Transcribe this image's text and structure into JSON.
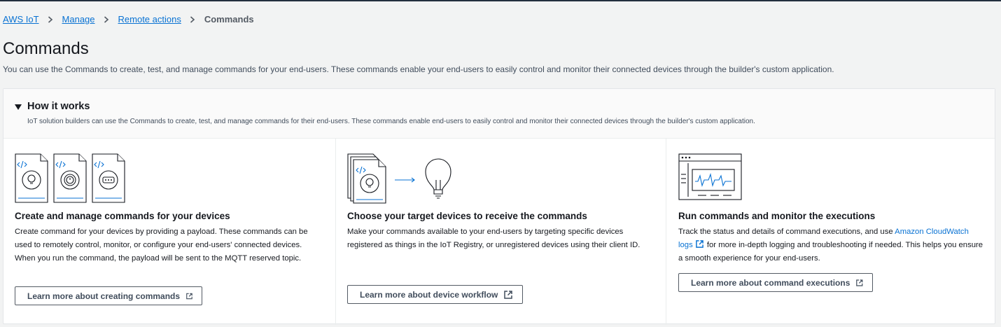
{
  "breadcrumb": {
    "items": [
      "AWS IoT",
      "Manage",
      "Remote actions"
    ],
    "current": "Commands"
  },
  "page": {
    "title": "Commands",
    "description": "You can use the Commands to create, test, and manage commands for your end-users. These commands enable your end-users to easily control and monitor their connected devices through the builder's custom application."
  },
  "how_it_works": {
    "title": "How it works",
    "subtitle": "IoT solution builders can use the Commands to create, test, and manage commands for their end-users. These commands enable end-users to easily control and monitor their connected devices through the builder's custom application.",
    "columns": [
      {
        "title": "Create and manage commands for your devices",
        "body": "Create command for your devices by providing a payload. These commands can be used to remotely control, monitor, or configure your end-users' connected devices. When you run the command, the payload will be sent to the MQTT reserved topic.",
        "button": "Learn more about creating commands",
        "illustration": "three-command-documents-icon"
      },
      {
        "title": "Choose your target devices to receive the commands",
        "body": "Make your commands available to your end-users by targeting specific devices registered as things in the IoT Registry, or unregistered devices using their client ID.",
        "button": "Learn more about device workflow",
        "illustration": "command-to-lightbulb-icon"
      },
      {
        "title": "Run commands and monitor the executions",
        "body_before": "Track the status and details of command executions, and use",
        "link": "Amazon CloudWatch logs",
        "body_after": "for more in-depth logging and troubleshooting if needed. This helps you ensure a smooth experience for your end-users.",
        "button": "Learn more about command executions",
        "illustration": "monitoring-dashboard-icon"
      }
    ]
  },
  "colors": {
    "link": "#0972d3",
    "text": "#16191f",
    "background": "#f2f3f3",
    "accent_blue": "#0972d3"
  }
}
